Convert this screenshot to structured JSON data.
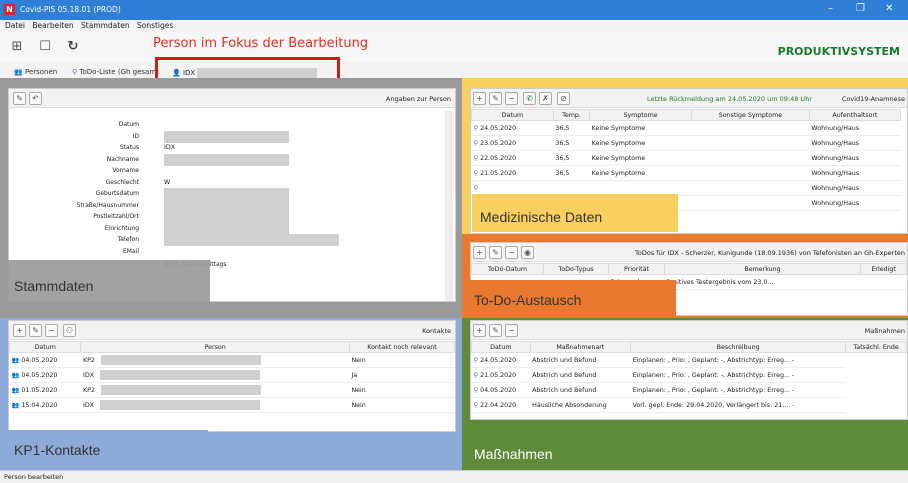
{
  "window": {
    "title": "Covid-PIS 05.18.01 (PROD)",
    "logo": "N"
  },
  "menu": [
    "Datei",
    "Bearbeiten",
    "Stammdaten",
    "Sonstiges"
  ],
  "header": {
    "system": "PRODUKTIVSYSTEM",
    "focus_note": "Person im Fokus der Bearbeitung"
  },
  "tabs": [
    {
      "label": "Personen"
    },
    {
      "label": "ToDo-Liste (Gh gesamt"
    },
    {
      "label": "IDX"
    }
  ],
  "stammdaten": {
    "title": "Angaben zur Person",
    "overlay": "Stammdaten",
    "fields": [
      {
        "label": "Datum",
        "value": ""
      },
      {
        "label": "ID",
        "value": ""
      },
      {
        "label": "Status",
        "value": "IDX"
      },
      {
        "label": "Nachname",
        "value": ""
      },
      {
        "label": "Vorname",
        "value": ""
      },
      {
        "label": "Geschlecht",
        "value": "W"
      },
      {
        "label": "Geburtsdatum",
        "value": ""
      },
      {
        "label": "Straße/Hausnummer",
        "value": ""
      },
      {
        "label": "Postleitzahl/Ort",
        "value": ""
      },
      {
        "label": "Einrichtung",
        "value": ""
      },
      {
        "label": "Telefon",
        "value": ""
      },
      {
        "label": "EMail",
        "value": ""
      }
    ],
    "extra_text": "Di Fr., Sa. vormittags"
  },
  "medizin": {
    "status_text": "Letzte Rückmeldung am 24.05.2020 um 09:48 Uhr",
    "title": "Covid19-Anamnese",
    "overlay": "Medizinische Daten",
    "columns": [
      "Datum",
      "Temp.",
      "Symptome",
      "Sonstige Symptome",
      "Aufenthaltsort"
    ],
    "rows": [
      [
        "24.05.2020",
        "36,5",
        "Keine Symptome",
        "",
        "Wohnung/Haus"
      ],
      [
        "23.05.2020",
        "36,5",
        "Keine Symptome",
        "",
        "Wohnung/Haus"
      ],
      [
        "22.05.2020",
        "36,5",
        "Keine Symptome",
        "",
        "Wohnung/Haus"
      ],
      [
        "21.05.2020",
        "36,5",
        "Keine Symptome",
        "",
        "Wohnung/Haus"
      ],
      [
        "",
        "",
        "",
        "",
        "Wohnung/Haus"
      ],
      [
        "",
        "",
        "",
        "",
        "Wohnung/Haus"
      ]
    ]
  },
  "todo": {
    "title": "ToDos für IDX - Scherzer, Kunigunde (18.09.1936) von Telefonisten an Gh-Experten",
    "overlay": "To-Do-Austausch",
    "columns": [
      "ToDo-Datum",
      "ToDo-Typus",
      "Priorität",
      "Bemerkung",
      "Erledigt"
    ],
    "rows": [
      [
        "",
        "",
        "Dringend",
        "Positives Testergebnis vom 23.0...",
        ""
      ]
    ]
  },
  "kontakte": {
    "title": "Kontakte",
    "overlay": "KP1-Kontakte",
    "columns": [
      "Datum",
      "Person",
      "Kontakt noch relevant"
    ],
    "rows": [
      [
        "04.05.2020",
        "KP2",
        "Nein"
      ],
      [
        "04.05.2020",
        "IDX",
        "Ja"
      ],
      [
        "01.05.2020",
        "KP2",
        "Nein"
      ],
      [
        "15.04.2020",
        "IDX",
        "Nein"
      ]
    ]
  },
  "massnahmen": {
    "title": "Maßnahmen",
    "overlay": "Maßnahmen",
    "columns": [
      "Datum",
      "Maßnahmenart",
      "Beschreibung",
      "Tatsächl. Ende"
    ],
    "rows": [
      [
        "24.05.2020",
        "Abstrich und Befund",
        "Einplanen: , Prio: , Geplant: -, Abstrichtyp: Erreg... -"
      ],
      [
        "21.05.2020",
        "Abstrich und Befund",
        "Einplanen: , Prio: , Geplant: -, Abstrichtyp: Erreg... -"
      ],
      [
        "04.05.2020",
        "Abstrich und Befund",
        "Einplanen: , Prio: , Geplant: -, Abstrichtyp: Erreg... -"
      ],
      [
        "22.04.2020",
        "Häusliche Absonderung",
        "Vorl. gepl. Ende: 29.04.2020, Verlängert bis: 21.... -"
      ]
    ]
  },
  "status_bar": "Person bearbeiten",
  "colors": {
    "stammdaten": "#9a9a9a",
    "medizin": "#f7d060",
    "todo": "#e8792e",
    "kontakte": "#8eaad9",
    "massnahmen": "#5e8a3a"
  }
}
